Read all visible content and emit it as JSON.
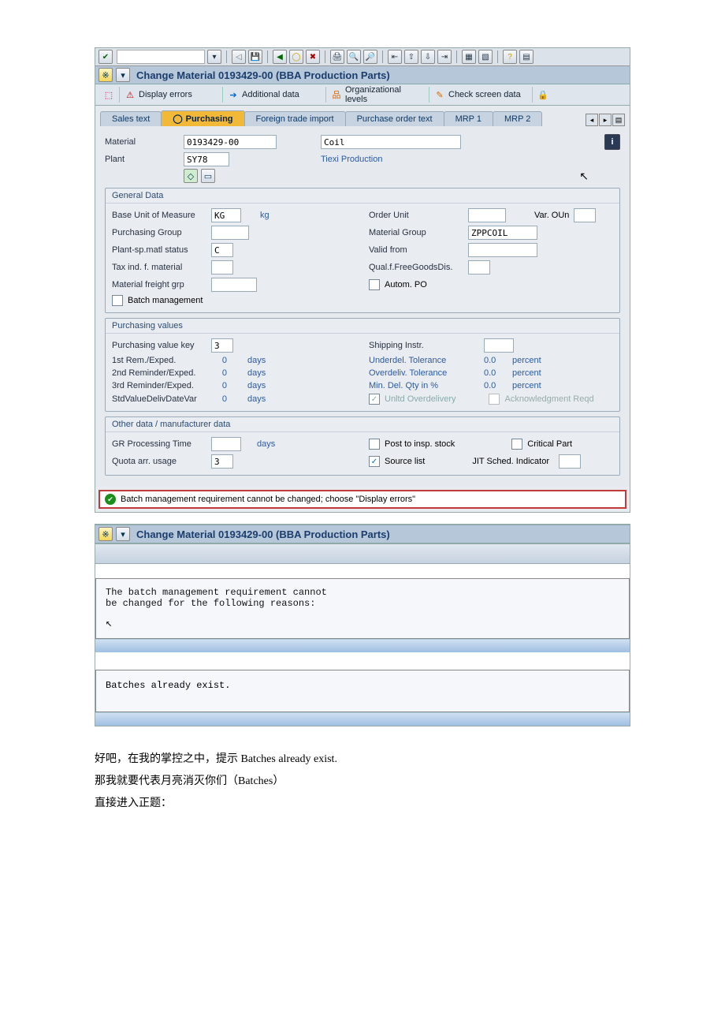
{
  "header": {
    "title": "Change Material 0193429-00 (BBA Production Parts)"
  },
  "buttons": {
    "display_errors": "Display errors",
    "additional_data": "Additional data",
    "org_levels": "Organizational levels",
    "check_screen": "Check screen data"
  },
  "tabs": {
    "sales_text": "Sales text",
    "purchasing": "Purchasing",
    "foreign_trade": "Foreign trade import",
    "po_text": "Purchase order text",
    "mrp1": "MRP 1",
    "mrp2": "MRP 2"
  },
  "material": {
    "label": "Material",
    "number": "0193429-00",
    "desc": "Coil"
  },
  "plant": {
    "label": "Plant",
    "code": "SY78",
    "name": "Tiexi Production"
  },
  "general": {
    "title": "General Data",
    "base_uom_l": "Base Unit of Measure",
    "base_uom_v": "KG",
    "base_uom_t": "kg",
    "order_unit_l": "Order Unit",
    "var_oun": "Var. OUn",
    "purch_grp_l": "Purchasing Group",
    "mat_grp_l": "Material Group",
    "mat_grp_v": "ZPPCOIL",
    "plant_status_l": "Plant-sp.matl status",
    "plant_status_v": "C",
    "valid_from_l": "Valid from",
    "tax_ind_l": "Tax ind. f. material",
    "qual_l": "Qual.f.FreeGoodsDis.",
    "mat_freight_l": "Material freight grp",
    "autom_po": "Autom. PO",
    "batch_mgmt": "Batch management"
  },
  "purch_values": {
    "title": "Purchasing values",
    "pvk_l": "Purchasing value key",
    "pvk_v": "3",
    "ship_l": "Shipping Instr.",
    "rem1_l": "1st Rem./Exped.",
    "rem1_v": "0",
    "rem2_l": "2nd Reminder/Exped.",
    "rem2_v": "0",
    "rem3_l": "3rd Reminder/Exped.",
    "rem3_v": "0",
    "std_l": "StdValueDelivDateVar",
    "std_v": "0",
    "days": "days",
    "under_l": "Underdel. Tolerance",
    "under_v": "0.0",
    "over_l": "Overdeliv. Tolerance",
    "over_v": "0.0",
    "minq_l": "Min. Del. Qty in %",
    "minq_v": "0.0",
    "percent": "percent",
    "unltd": "Unltd Overdelivery",
    "ack": "Acknowledgment Reqd"
  },
  "other": {
    "title": "Other data / manufacturer data",
    "gr_l": "GR Processing Time",
    "days": "days",
    "post_insp": "Post to insp. stock",
    "critical": "Critical Part",
    "quota_l": "Quota arr. usage",
    "quota_v": "3",
    "source_list": "Source list",
    "jit_l": "JIT Sched. Indicator"
  },
  "status": {
    "msg": "Batch management requirement cannot be changed; choose \"Display errors\""
  },
  "win2": {
    "title": "Change Material 0193429-00 (BBA Production Parts)",
    "msg1": "The batch management requirement cannot",
    "msg2": "be changed for the following reasons:",
    "msg3": "Batches already exist."
  },
  "bodytext": {
    "p1": "好吧，在我的掌控之中，提示 Batches already exist.",
    "p2": "那我就要代表月亮消灭你们（Batches）",
    "p3": "直接进入正题："
  }
}
